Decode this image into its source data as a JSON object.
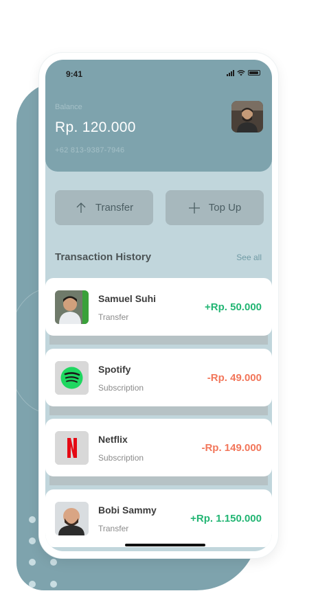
{
  "status": {
    "time": "9:41"
  },
  "header": {
    "balance_label": "Balance",
    "balance_value": "Rp. 120.000",
    "phone_number": "+62 813-9387-7946"
  },
  "actions": {
    "transfer_label": "Transfer",
    "topup_label": "Top Up"
  },
  "history": {
    "title": "Transaction History",
    "see_all": "See all",
    "items": [
      {
        "name": "Samuel Suhi",
        "type": "Transfer",
        "amount": "+Rp. 50.000",
        "direction": "in",
        "icon": "samuel-avatar"
      },
      {
        "name": "Spotify",
        "type": "Subscription",
        "amount": "-Rp. 49.000",
        "direction": "out",
        "icon": "spotify-icon"
      },
      {
        "name": "Netflix",
        "type": "Subscription",
        "amount": "-Rp. 149.000",
        "direction": "out",
        "icon": "netflix-icon"
      },
      {
        "name": "Bobi Sammy",
        "type": "Transfer",
        "amount": "+Rp. 1.150.000",
        "direction": "in",
        "icon": "bobi-avatar"
      }
    ]
  },
  "colors": {
    "accent": "#7ea3ad",
    "background": "#c1d6dc",
    "positive": "#22b573",
    "negative": "#f2765a"
  }
}
